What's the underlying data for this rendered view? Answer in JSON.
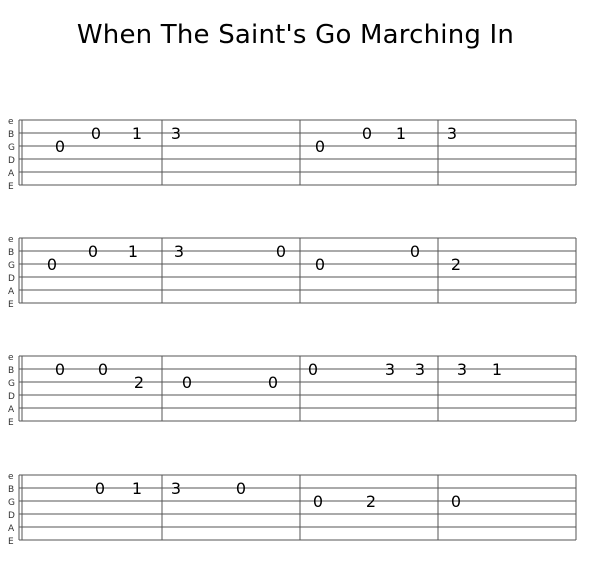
{
  "title": "When The Saint's Go Marching In",
  "strings": [
    "e",
    "B",
    "G",
    "D",
    "A",
    "E"
  ],
  "staves": [
    {
      "measures": [
        [
          {
            "s": 2,
            "f": "0"
          },
          {
            "s": 1,
            "f": "0"
          },
          {
            "s": 1,
            "f": "1"
          }
        ],
        [
          {
            "s": 1,
            "f": "3"
          }
        ],
        [
          {
            "s": 2,
            "f": "0"
          },
          {
            "s": 1,
            "f": "0"
          },
          {
            "s": 1,
            "f": "1"
          }
        ],
        [
          {
            "s": 1,
            "f": "3"
          }
        ]
      ]
    },
    {
      "measures": [
        [
          {
            "s": 2,
            "f": "0"
          },
          {
            "s": 1,
            "f": "0"
          },
          {
            "s": 1,
            "f": "1"
          }
        ],
        [
          {
            "s": 1,
            "f": "3"
          },
          {
            "s": 1,
            "f": "0"
          }
        ],
        [
          {
            "s": 2,
            "f": "0"
          },
          {
            "s": 1,
            "f": "0"
          }
        ],
        [
          {
            "s": 2,
            "f": "2"
          }
        ]
      ]
    },
    {
      "measures": [
        [
          {
            "s": 1,
            "f": "0"
          },
          {
            "s": 1,
            "f": "0"
          },
          {
            "s": 2,
            "f": "2"
          }
        ],
        [
          {
            "s": 2,
            "f": "0"
          },
          {
            "s": 2,
            "f": "0"
          }
        ],
        [
          {
            "s": 1,
            "f": "0"
          },
          {
            "s": 1,
            "f": "3"
          },
          {
            "s": 1,
            "f": "3"
          }
        ],
        [
          {
            "s": 1,
            "f": "3"
          },
          {
            "s": 1,
            "f": "1"
          }
        ]
      ]
    },
    {
      "measures": [
        [
          {
            "s": 1,
            "f": "0"
          },
          {
            "s": 1,
            "f": "1"
          }
        ],
        [
          {
            "s": 1,
            "f": "3"
          },
          {
            "s": 1,
            "f": "0"
          }
        ],
        [
          {
            "s": 2,
            "f": "0"
          },
          {
            "s": 2,
            "f": "2"
          }
        ],
        [
          {
            "s": 2,
            "f": "0"
          }
        ]
      ]
    }
  ]
}
